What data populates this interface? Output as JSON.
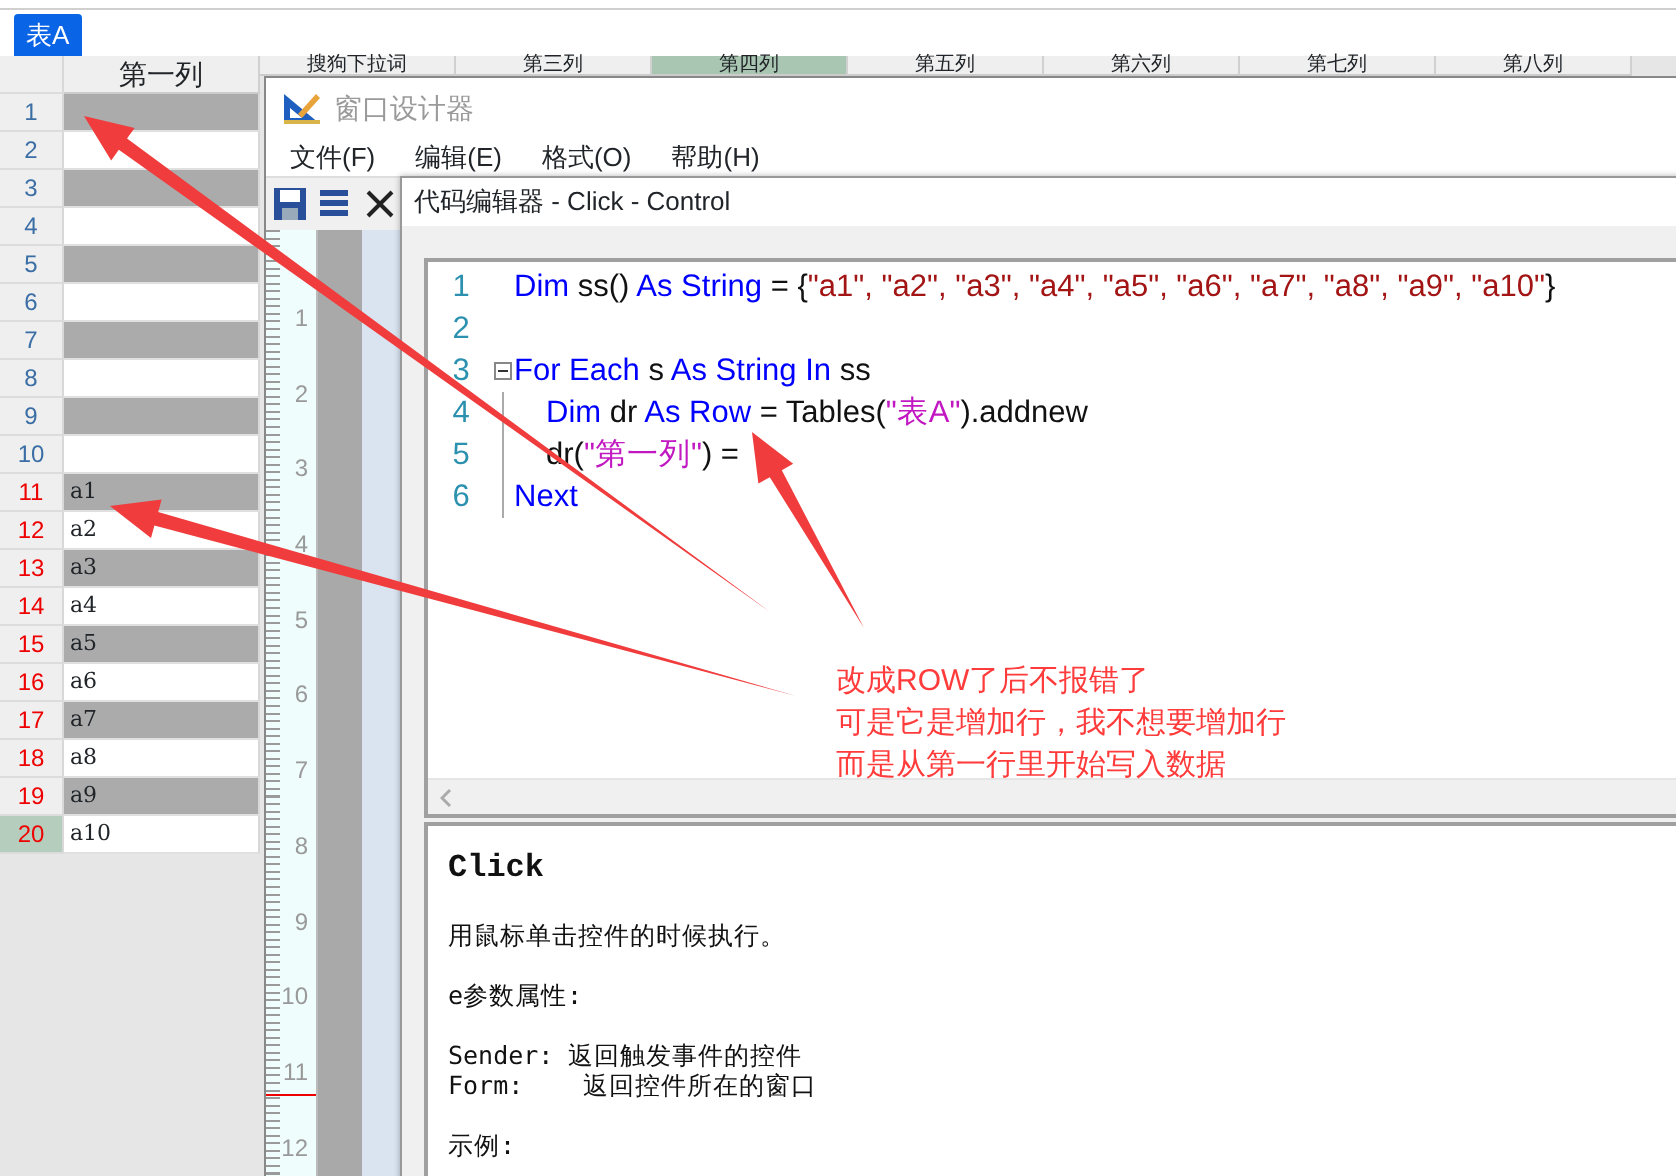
{
  "sheet_tabs": [
    {
      "label": "表A",
      "selected": true
    }
  ],
  "table": {
    "columns": [
      {
        "label": "第一列",
        "selected": false
      },
      {
        "label": "搜狗下拉词",
        "selected": false
      },
      {
        "label": "第三列",
        "selected": false
      },
      {
        "label": "第四列",
        "selected": true
      },
      {
        "label": "第五列",
        "selected": false
      },
      {
        "label": "第六列",
        "selected": false
      },
      {
        "label": "第七列",
        "selected": false
      },
      {
        "label": "第八列",
        "selected": false
      }
    ],
    "rows": [
      {
        "number": "1",
        "new": false,
        "selected": false
      },
      {
        "number": "2",
        "new": false,
        "selected": false
      },
      {
        "number": "3",
        "new": false,
        "selected": false
      },
      {
        "number": "4",
        "new": false,
        "selected": false
      },
      {
        "number": "5",
        "new": false,
        "selected": false
      },
      {
        "number": "6",
        "new": false,
        "selected": false
      },
      {
        "number": "7",
        "new": false,
        "selected": false
      },
      {
        "number": "8",
        "new": false,
        "selected": false
      },
      {
        "number": "9",
        "new": false,
        "selected": false
      },
      {
        "number": "10",
        "new": false,
        "selected": false
      },
      {
        "number": "11",
        "value": "a1",
        "new": true,
        "selected": false
      },
      {
        "number": "12",
        "value": "a2",
        "new": true,
        "selected": false
      },
      {
        "number": "13",
        "value": "a3",
        "new": true,
        "selected": false
      },
      {
        "number": "14",
        "value": "a4",
        "new": true,
        "selected": false
      },
      {
        "number": "15",
        "value": "a5",
        "new": true,
        "selected": false
      },
      {
        "number": "16",
        "value": "a6",
        "new": true,
        "selected": false
      },
      {
        "number": "17",
        "value": "a7",
        "new": true,
        "selected": false
      },
      {
        "number": "18",
        "value": "a8",
        "new": true,
        "selected": false
      },
      {
        "number": "19",
        "value": "a9",
        "new": true,
        "selected": false
      },
      {
        "number": "20",
        "value": "a10",
        "new": true,
        "selected": true
      }
    ]
  },
  "designer_window": {
    "title": "窗口设计器",
    "menu": [
      "文件(F)",
      "编辑(E)",
      "格式(O)",
      "帮助(H)"
    ],
    "ruler_marks": [
      "1",
      "2",
      "3",
      "4",
      "5",
      "6",
      "7",
      "8",
      "9",
      "10",
      "11",
      "12"
    ]
  },
  "code_editor": {
    "title": "代码编辑器 - Click - Control",
    "lines": [
      {
        "number": "1",
        "foldable": false,
        "indent": false,
        "tokens": [
          {
            "kind": "keyword",
            "text": "Dim"
          },
          {
            "kind": "plain",
            "text": " ss() "
          },
          {
            "kind": "keyword",
            "text": "As String"
          },
          {
            "kind": "plain",
            "text": " = {"
          },
          {
            "kind": "string",
            "text": "\"a1\", \"a2\", \"a3\", \"a4\", \"a5\", \"a6\", \"a7\", \"a8\", \"a9\", \"a10\""
          },
          {
            "kind": "plain",
            "text": "}"
          }
        ]
      },
      {
        "number": "2",
        "foldable": false
      },
      {
        "number": "3",
        "foldable": true,
        "indent": false,
        "tokens": [
          {
            "kind": "keyword",
            "text": "For Each"
          },
          {
            "kind": "plain",
            "text": " s "
          },
          {
            "kind": "keyword",
            "text": "As String In"
          },
          {
            "kind": "plain",
            "text": " ss"
          }
        ]
      },
      {
        "number": "4",
        "foldable": false,
        "indent": true,
        "tokens": [
          {
            "kind": "keyword",
            "text": "Dim"
          },
          {
            "kind": "plain",
            "text": " dr "
          },
          {
            "kind": "keyword",
            "text": "As Row"
          },
          {
            "kind": "plain",
            "text": " = Tables("
          },
          {
            "kind": "text-string",
            "text": "\"表A\""
          },
          {
            "kind": "plain",
            "text": ").addnew"
          }
        ]
      },
      {
        "number": "5",
        "foldable": false,
        "indent": true,
        "tokens": [
          {
            "kind": "plain",
            "text": "dr("
          },
          {
            "kind": "text-string",
            "text": "\"第一列\""
          },
          {
            "kind": "plain",
            "text": ") ="
          }
        ]
      },
      {
        "number": "6",
        "foldable": false,
        "indent": false,
        "tokens": [
          {
            "kind": "keyword",
            "text": "Next"
          }
        ]
      }
    ],
    "help": {
      "heading": "Click",
      "paragraphs": [
        [
          "用鼠标单击控件的时候执行。"
        ],
        [
          "e参数属性:"
        ],
        [
          "Sender: 返回触发事件的控件",
          "Form:    返回控件所在的窗口"
        ],
        [
          "示例:"
        ]
      ]
    }
  },
  "annotation": {
    "lines": [
      "改成ROW了后不报错了",
      "可是它是增加行，我不想要增加行",
      "而是从第一行里开始写入数据"
    ]
  }
}
